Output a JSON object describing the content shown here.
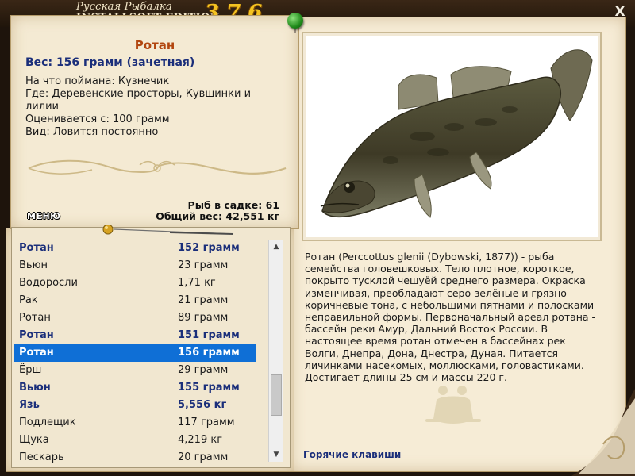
{
  "window": {
    "brand_top": "Русская Рыбалка",
    "brand_bottom": "INSTALLSOFT EDITION",
    "version": "3.7.6",
    "close_label": "X"
  },
  "catch": {
    "name": "Ротан",
    "weight_line": "Вес: 156 грамм (зачетная)",
    "bait_line": "На что поймана: Кузнечик",
    "location_line": "Где: Деревенские просторы, Кувшинки и лилии",
    "threshold_line": "Оценивается с: 100 грамм",
    "type_line": "Вид: Ловится постоянно"
  },
  "stats": {
    "fish_in_keepnet": "Рыб в садке: 61",
    "total_weight": "Общий вес: 42,551 кг"
  },
  "menu": {
    "label": "МЕНЮ"
  },
  "fish_list": [
    {
      "name": "Ротан",
      "weight": "152 грамм",
      "bold": true,
      "selected": false
    },
    {
      "name": "Вьюн",
      "weight": "23 грамм",
      "bold": false,
      "selected": false
    },
    {
      "name": "Водоросли",
      "weight": "1,71 кг",
      "bold": false,
      "selected": false
    },
    {
      "name": "Рак",
      "weight": "21 грамм",
      "bold": false,
      "selected": false
    },
    {
      "name": "Ротан",
      "weight": "89 грамм",
      "bold": false,
      "selected": false
    },
    {
      "name": "Ротан",
      "weight": "151 грамм",
      "bold": true,
      "selected": false
    },
    {
      "name": "Ротан",
      "weight": "156 грамм",
      "bold": true,
      "selected": true
    },
    {
      "name": "Ёрш",
      "weight": "29 грамм",
      "bold": false,
      "selected": false
    },
    {
      "name": "Вьюн",
      "weight": "155 грамм",
      "bold": true,
      "selected": false
    },
    {
      "name": "Язь",
      "weight": "5,556 кг",
      "bold": true,
      "selected": false
    },
    {
      "name": "Подлещик",
      "weight": "117 грамм",
      "bold": false,
      "selected": false
    },
    {
      "name": "Щука",
      "weight": "4,219 кг",
      "bold": false,
      "selected": false
    },
    {
      "name": "Пескарь",
      "weight": "20 грамм",
      "bold": false,
      "selected": false
    }
  ],
  "description": "Ротан (Perccottus glenii (Dybowski, 1877)) - рыба семейства головешковых. Тело плотное, короткое, покрыто тусклой чешуёй среднего размера. Окраска изменчивая, преобладают серо-зелёные и грязно-коричневые тона, с небольшими пятнами и полосками неправильной формы. Первоначальный ареал ротана - бассейн реки Амур, Дальний Восток России. В настоящее время ротан отмечен в бассейнах рек Волги, Днепра, Дона, Днестра, Дуная. Питается личинками насекомых, моллюсками, головастиками. Достигает длины 25 см и массы 220 г.",
  "hotkeys": {
    "label": "Горячие клавиши"
  },
  "colors": {
    "title_orange": "#b2460f",
    "weight_blue": "#1a2e7a",
    "selection_blue": "#0f6fd6",
    "version_gold": "#f4c321"
  },
  "icons": {
    "close": "close-icon",
    "pin": "pin-icon",
    "fish_photo": "rotan-fish-image",
    "ornament": "ornament-divider-icon",
    "watermark": "watermark-icon",
    "float": "fishing-float-icon",
    "scroll_up": "chevron-up-icon",
    "scroll_down": "chevron-down-icon"
  }
}
